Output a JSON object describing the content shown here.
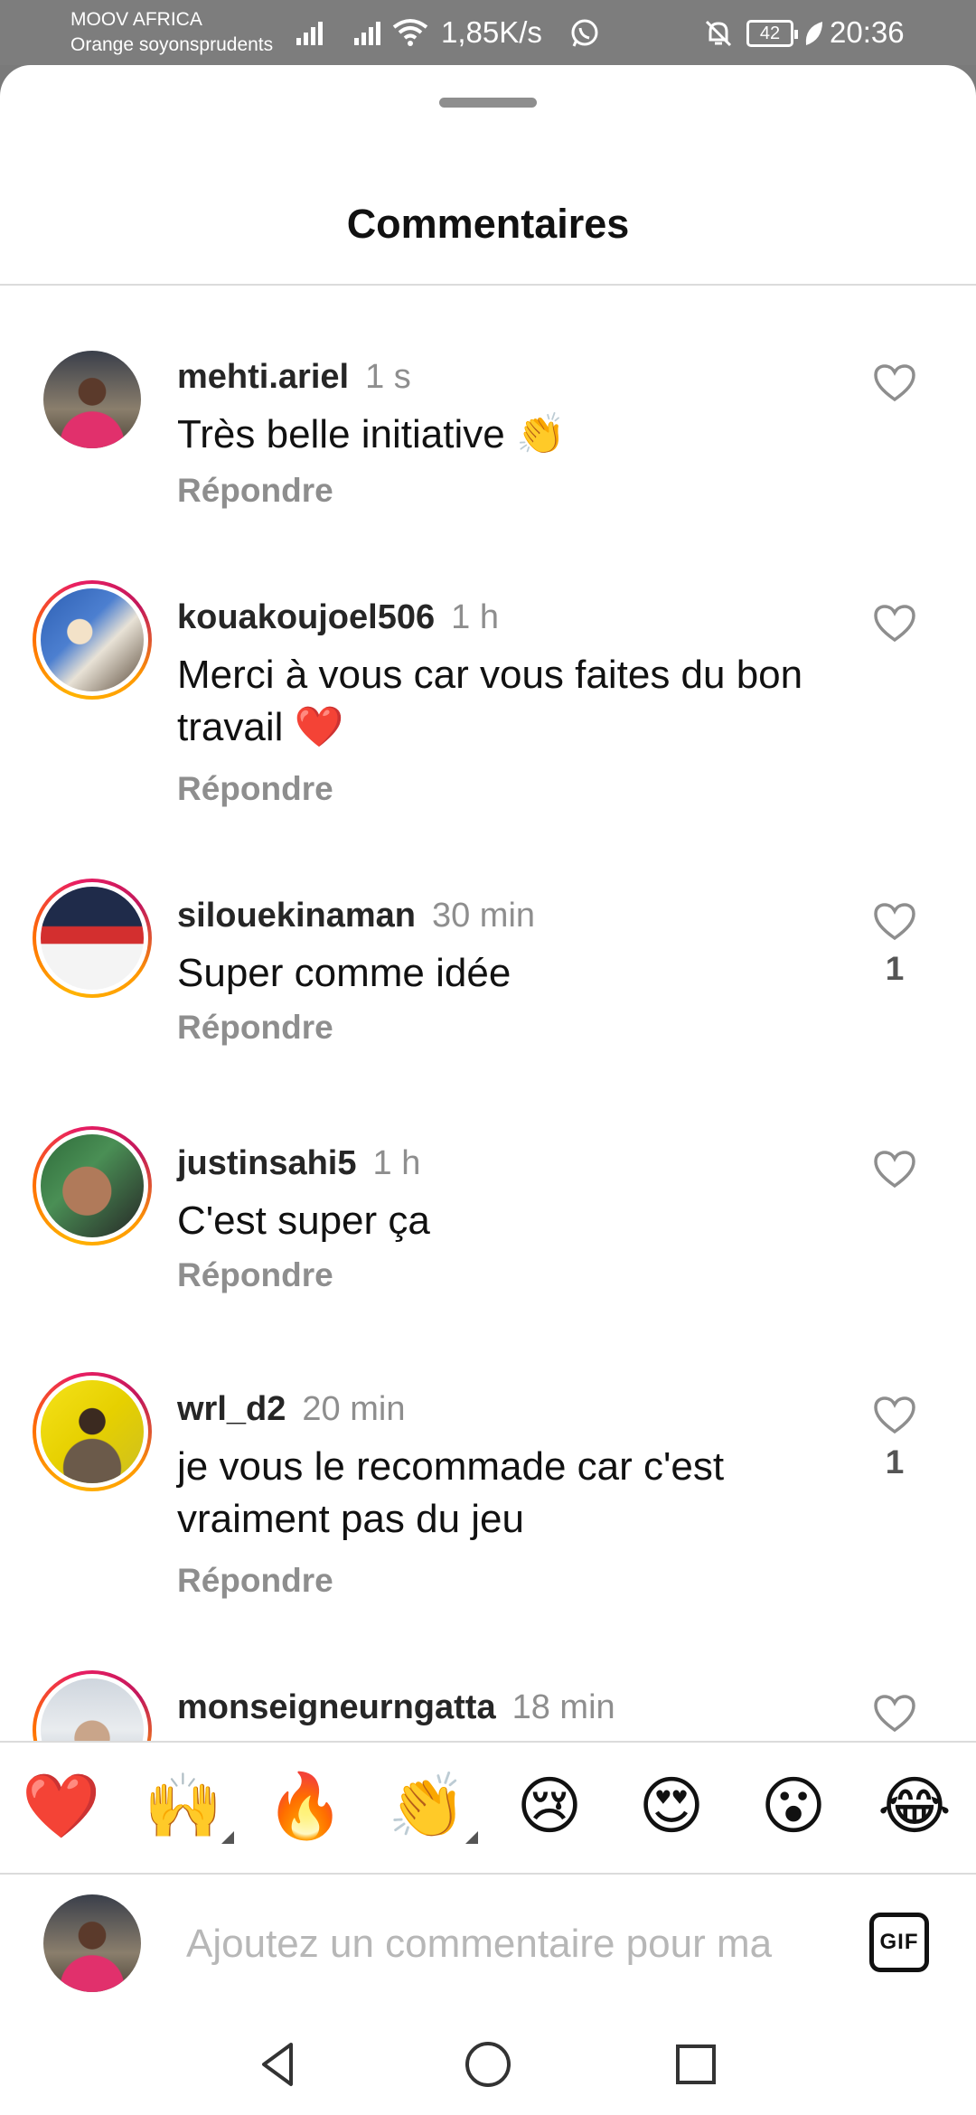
{
  "status_bar": {
    "carrier_line1": "MOOV AFRICA",
    "carrier_line2": "Orange soyonsprudents",
    "speed": "1,85K/s",
    "battery": "42",
    "time": "20:36"
  },
  "sheet": {
    "title": "Commentaires"
  },
  "comments": [
    {
      "username": "mehti.ariel",
      "time": "1 s",
      "text": "Très belle initiative 👏",
      "reply_label": "Répondre",
      "likes": ""
    },
    {
      "username": "kouakoujoel506",
      "time": "1 h",
      "text": "Merci à vous car vous faites du bon travail ❤️",
      "reply_label": "Répondre",
      "likes": ""
    },
    {
      "username": "silouekinaman",
      "time": "30 min",
      "text": "Super comme idée",
      "reply_label": "Répondre",
      "likes": "1"
    },
    {
      "username": "justinsahi5",
      "time": "1 h",
      "text": "C'est super ça",
      "reply_label": "Répondre",
      "likes": ""
    },
    {
      "username": "wrl_d2",
      "time": "20 min",
      "text": "je vous le recommade car c'est vraiment pas du jeu",
      "reply_label": "Répondre",
      "likes": "1"
    },
    {
      "username": "monseigneurngatta",
      "time": "18 min",
      "text": "",
      "reply_label": "",
      "likes": ""
    }
  ],
  "emoji_bar": [
    "❤️",
    "🙌",
    "🔥",
    "👏",
    "😢",
    "😍",
    "😮",
    "😂"
  ],
  "input": {
    "placeholder": "Ajoutez un commentaire pour ma",
    "gif_label": "GIF"
  },
  "colors": {
    "status_bar_bg": "#7d7d7d",
    "story_ring": "#e91e63",
    "muted_text": "#8e8e8e",
    "heart_red": "#e0245e"
  }
}
